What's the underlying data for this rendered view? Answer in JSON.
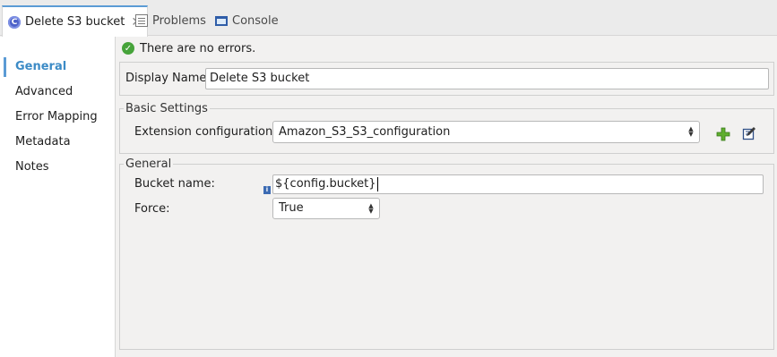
{
  "tabs": [
    {
      "label": "Delete S3 bucket",
      "icon": "mule-component-icon",
      "active": true,
      "closable": true
    },
    {
      "label": "Problems",
      "icon": "problems-icon",
      "active": false
    },
    {
      "label": "Console",
      "icon": "console-icon",
      "active": false
    }
  ],
  "sidebar": {
    "items": [
      {
        "label": "General",
        "active": true
      },
      {
        "label": "Advanced"
      },
      {
        "label": "Error Mapping"
      },
      {
        "label": "Metadata"
      },
      {
        "label": "Notes"
      }
    ]
  },
  "status": {
    "text": "There are no errors.",
    "icon": "check-circle-icon",
    "color": "#46a33a"
  },
  "display_name": {
    "label": "Display Name:",
    "value": "Delete S3 bucket"
  },
  "basic_settings": {
    "title": "Basic Settings",
    "extension_label": "Extension configuration:",
    "extension_value": "Amazon_S3_S3_configuration",
    "add_icon": "plus-icon",
    "edit_icon": "edit-icon"
  },
  "general": {
    "title": "General",
    "bucket_label": "Bucket name:",
    "bucket_value": "${config.bucket}",
    "force_label": "Force:",
    "force_value": "True"
  },
  "colors": {
    "accent": "#5b9bd5",
    "active_nav": "#3c8bc6"
  }
}
